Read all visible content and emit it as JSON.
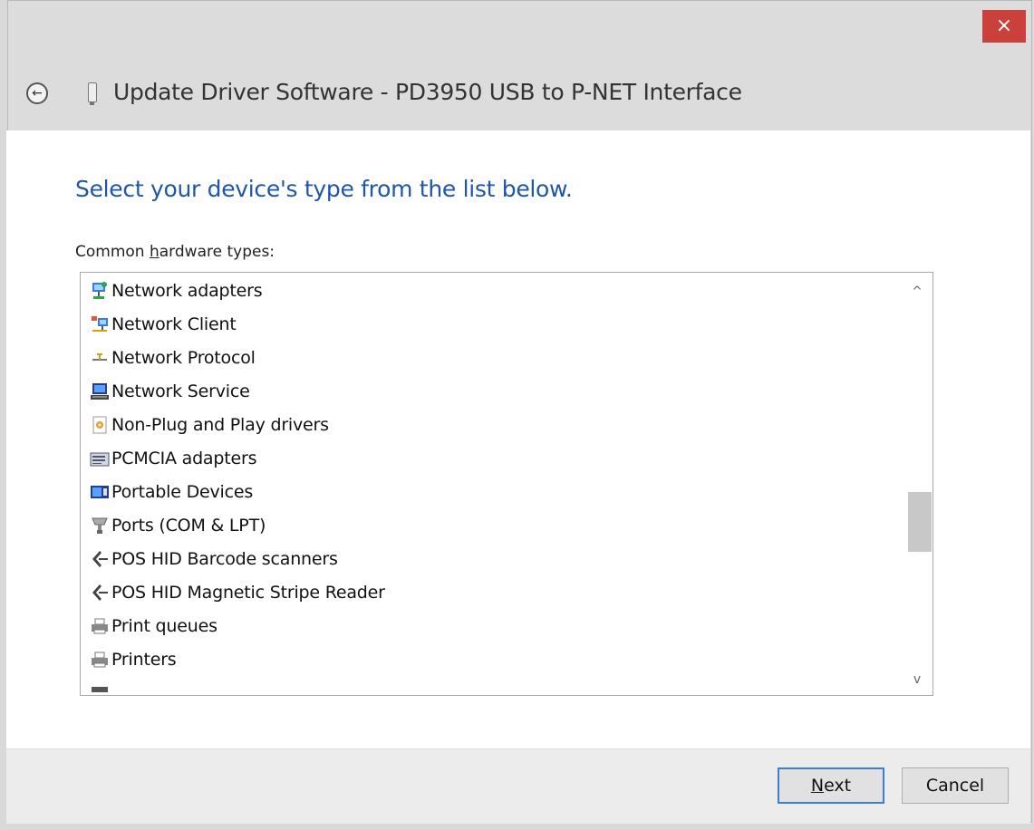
{
  "window": {
    "close_label": "×",
    "back_label": "←",
    "title": "Update Driver Software - PD3950 USB to P-NET Interface"
  },
  "content": {
    "heading": "Select your device's type from the list below.",
    "list_label_prefix": "Common ",
    "list_label_accel": "h",
    "list_label_suffix": "ardware types:"
  },
  "list": {
    "items": [
      {
        "label": "Network adapters",
        "icon": "network-adapter-icon"
      },
      {
        "label": "Network Client",
        "icon": "network-client-icon"
      },
      {
        "label": "Network Protocol",
        "icon": "network-protocol-icon"
      },
      {
        "label": "Network Service",
        "icon": "network-service-icon"
      },
      {
        "label": "Non-Plug and Play drivers",
        "icon": "non-plug-and-play-icon"
      },
      {
        "label": "PCMCIA adapters",
        "icon": "pcmcia-icon"
      },
      {
        "label": "Portable Devices",
        "icon": "portable-devices-icon"
      },
      {
        "label": "Ports (COM & LPT)",
        "icon": "ports-icon"
      },
      {
        "label": "POS HID Barcode scanners",
        "icon": "pos-hid-icon"
      },
      {
        "label": "POS HID Magnetic Stripe Reader",
        "icon": "pos-hid-icon"
      },
      {
        "label": "Print queues",
        "icon": "printer-icon"
      },
      {
        "label": "Printers",
        "icon": "printer-icon"
      }
    ],
    "scroll_up": "^",
    "scroll_down": "v",
    "scroll_position": 0.55
  },
  "footer": {
    "next_accel": "N",
    "next_rest": "ext",
    "cancel_label": "Cancel"
  },
  "colors": {
    "heading": "#1f56a8",
    "close": "#c9413a",
    "focus_border": "#3c7fd1"
  }
}
